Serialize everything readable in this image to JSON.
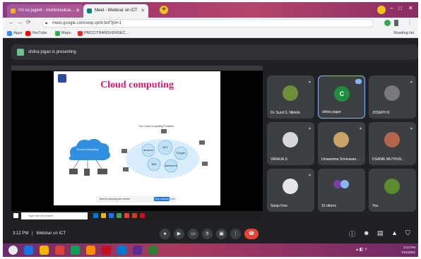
{
  "browser": {
    "tabs": [
      {
        "label": "I'm so jugent - mohininaikse...",
        "active": false
      },
      {
        "label": "Meet - Webinar on ICT",
        "active": true
      }
    ],
    "url": "meet.google.com/wxp-qxhl-bnf?pli=1",
    "bookmarks": [
      {
        "label": "Apps",
        "icon_color": "#4285f4"
      },
      {
        "label": "YouTube",
        "icon_color": "#ff0000"
      },
      {
        "label": "Maps",
        "icon_color": "#34a853"
      },
      {
        "label": "PNCC/TRANSVERSEC...",
        "icon_color": "#d93025"
      }
    ],
    "reading_list": "Reading list"
  },
  "meet": {
    "presenting_banner": "shilna jogan is presenting",
    "slide": {
      "title": "Cloud computing",
      "left_cloud_label": "Cloud Computing",
      "right_subtitle": "Two Cloud Computing Providers",
      "cloud_bubbles": [
        "amazon",
        "NET",
        "Google",
        "IBM",
        "salesforce"
      ],
      "notice_text": "Meet is sharing your screen",
      "notice_button": "Stop sharing",
      "notice_hide": "Hide"
    },
    "inner_taskbar": {
      "search_placeholder": "Type here to search"
    },
    "participants": [
      {
        "name": "Dr. Sunil S. Nikhde",
        "avatar_color": "#6f8f3a",
        "avatar_type": "photo",
        "active": false
      },
      {
        "name": "shilna jogan",
        "avatar_color": "#1e8e3e",
        "avatar_letter": "C",
        "avatar_type": "letter",
        "active": true
      },
      {
        "name": "JOSEPH K",
        "avatar_color": "#7a7a7a",
        "avatar_type": "photo",
        "active": false
      },
      {
        "name": "VANAJA.S",
        "avatar_color": "#d8d8d8",
        "avatar_type": "photo",
        "active": false
      },
      {
        "name": "Umaamma Srinivasan...",
        "avatar_color": "#caa466",
        "avatar_type": "photo",
        "active": false
      },
      {
        "name": "DSANIE MUTHUS...",
        "avatar_color": "#b4654a",
        "avatar_type": "photo",
        "active": false
      },
      {
        "name": "Sanju Fine",
        "avatar_color": "#e6e6e6",
        "avatar_type": "photo",
        "active": false
      },
      {
        "name": "16 others",
        "avatar_color": "#7b3fa0",
        "avatar_type": "group",
        "active": false
      },
      {
        "name": "You",
        "avatar_color": "#5c8c2e",
        "avatar_type": "photo",
        "active": false
      }
    ],
    "bottom": {
      "time": "3:12 PM",
      "separator": "|",
      "meeting_title": "Webinar on ICT"
    }
  },
  "windows": {
    "clock_time": "3:12 PM",
    "clock_date": "7/21/2021",
    "taskbar_colors": [
      "#1a73e8",
      "#f4b400",
      "#db4437",
      "#0f9d58",
      "#ff8c00",
      "#c50f1f",
      "#0078d4",
      "#5c2d91",
      "#2e7d32"
    ]
  }
}
